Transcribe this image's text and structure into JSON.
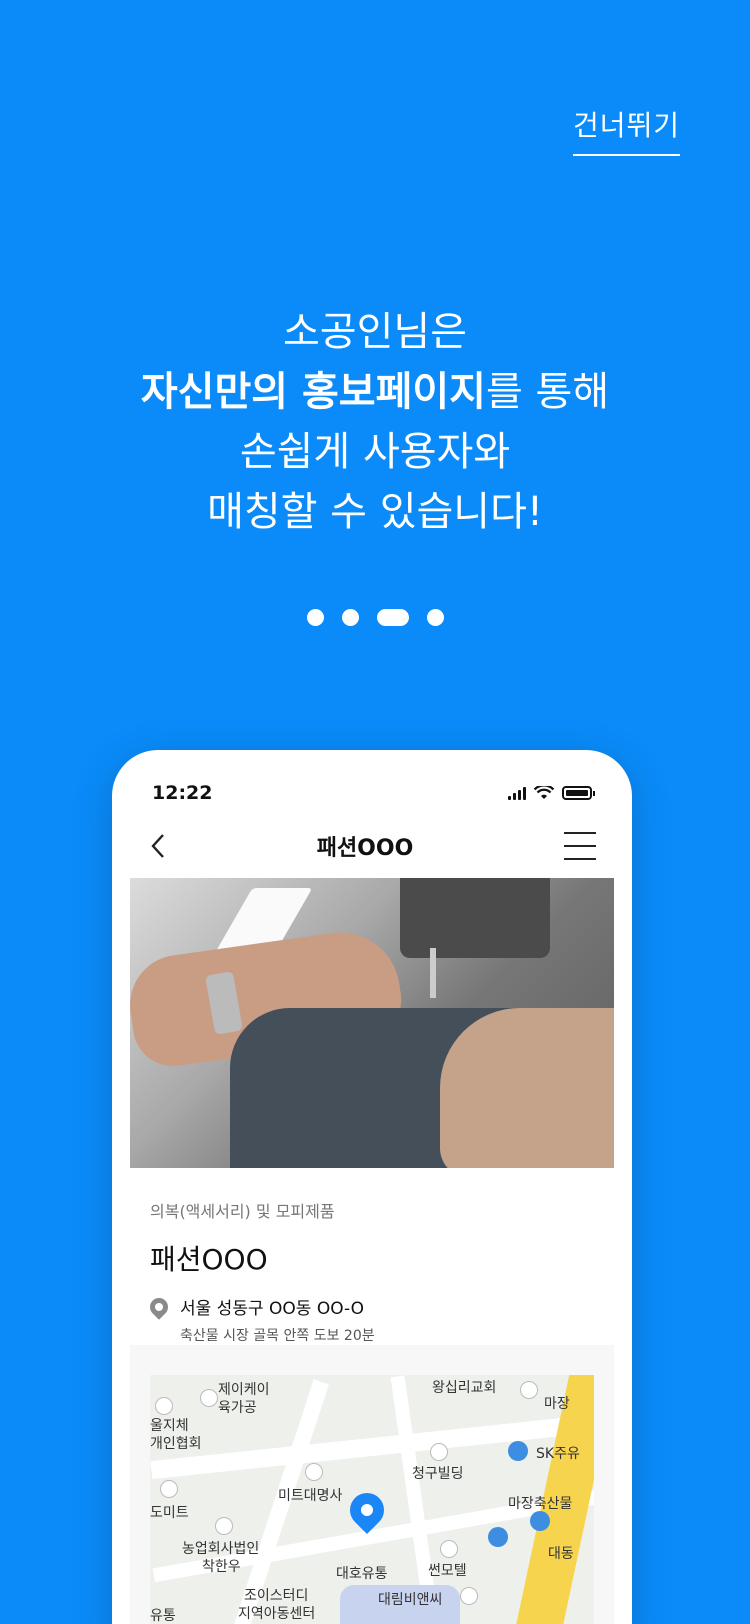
{
  "skip_label": "건너뛰기",
  "headline": {
    "line1": "소공인님은",
    "line2_bold": "자신만의 홍보페이지",
    "line2_rest": "를 통해",
    "line3": "손쉽게 사용자와",
    "line4": "매칭할 수 있습니다!"
  },
  "pagination": {
    "total": 4,
    "active_index": 3
  },
  "phone": {
    "status": {
      "time": "12:22"
    },
    "nav": {
      "title": "패션OOO"
    },
    "store": {
      "category": "의복(액세서리) 및 모피제품",
      "name": "패션OOO",
      "address": "서울 성동구 OO동 OO-O",
      "direction": "축산물 시장 골목 안쪽 도보 20분"
    },
    "map_labels": {
      "a": "제이케이",
      "b": "육가공",
      "c": "울지체",
      "d": "개인협회",
      "e": "왕십리교회",
      "f": "마장",
      "g": "SK주유",
      "h": "청구빌딩",
      "i": "미트대명사",
      "j": "도미트",
      "k": "마장축산물",
      "l": "농업회사법인",
      "m": "착한우",
      "n": "대호유통",
      "o": "썬모텔",
      "p": "대동",
      "q": "조이스터디",
      "r": "지역아동센터",
      "s": "대림비앤씨",
      "t": "유통"
    }
  }
}
